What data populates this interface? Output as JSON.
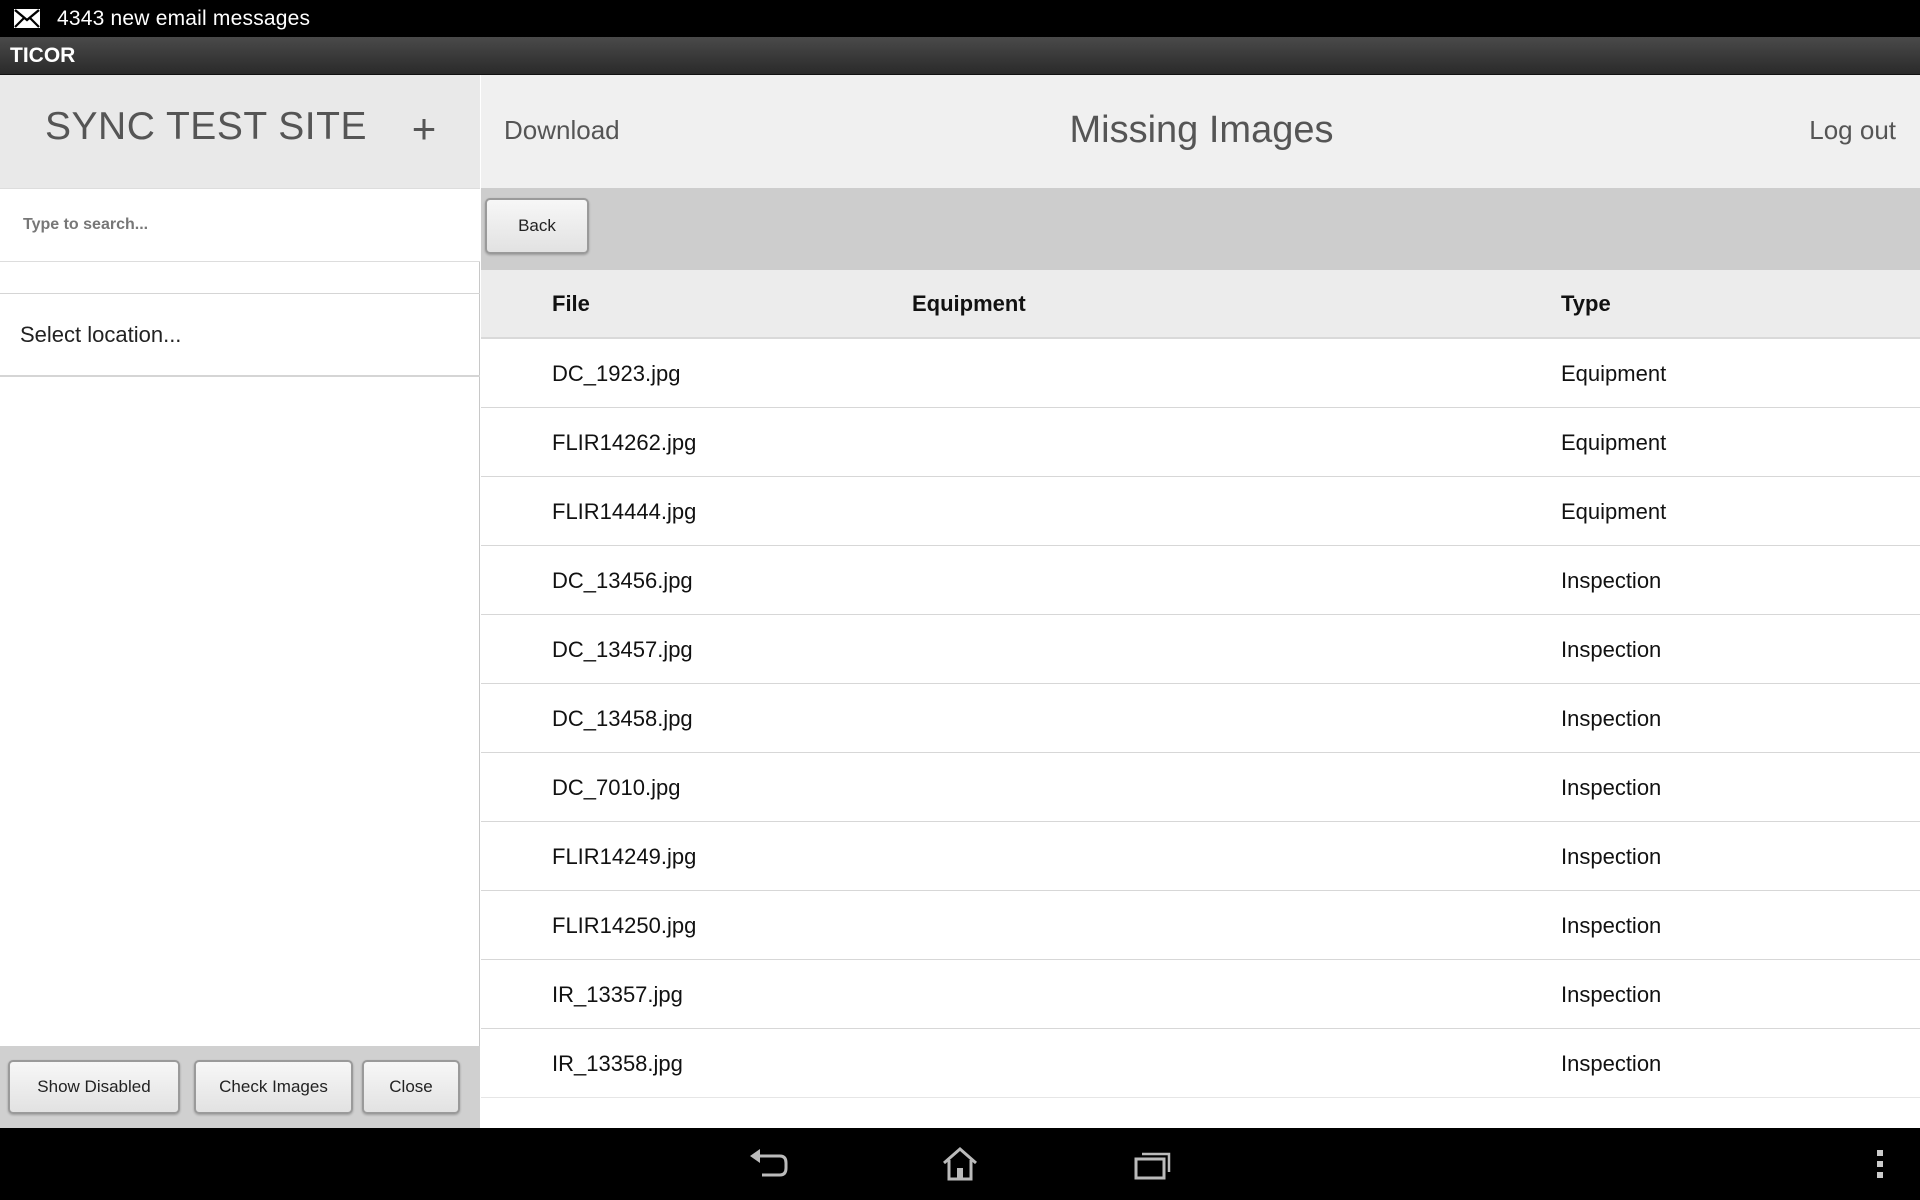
{
  "status_bar": {
    "icon": "mail-icon",
    "message": "4343 new email messages"
  },
  "title_bar": {
    "app_title": "TICOR"
  },
  "sidebar": {
    "site_title": "SYNC TEST SITE",
    "add_label": "+",
    "search_placeholder": "Type to search...",
    "location_label": "Select location...",
    "buttons": {
      "show_disabled": "Show Disabled",
      "check_images": "Check Images",
      "close": "Close"
    }
  },
  "header": {
    "download": "Download",
    "title": "Missing Images",
    "logout": "Log out"
  },
  "toolbar": {
    "back": "Back"
  },
  "table": {
    "columns": [
      "File",
      "Equipment",
      "Type"
    ],
    "rows": [
      {
        "file": "DC_1923.jpg",
        "equipment": "",
        "type": "Equipment"
      },
      {
        "file": "FLIR14262.jpg",
        "equipment": "",
        "type": "Equipment"
      },
      {
        "file": "FLIR14444.jpg",
        "equipment": "",
        "type": "Equipment"
      },
      {
        "file": "DC_13456.jpg",
        "equipment": "",
        "type": "Inspection"
      },
      {
        "file": "DC_13457.jpg",
        "equipment": "",
        "type": "Inspection"
      },
      {
        "file": "DC_13458.jpg",
        "equipment": "",
        "type": "Inspection"
      },
      {
        "file": "DC_7010.jpg",
        "equipment": "",
        "type": "Inspection"
      },
      {
        "file": "FLIR14249.jpg",
        "equipment": "",
        "type": "Inspection"
      },
      {
        "file": "FLIR14250.jpg",
        "equipment": "",
        "type": "Inspection"
      },
      {
        "file": "IR_13357.jpg",
        "equipment": "",
        "type": "Inspection"
      },
      {
        "file": "IR_13358.jpg",
        "equipment": "",
        "type": "Inspection"
      }
    ]
  },
  "nav_bar": {
    "icons": [
      "back-icon",
      "home-icon",
      "recent-apps-icon",
      "overflow-menu-icon"
    ]
  },
  "colors": {
    "sidebar_header_bg": "#e9e9e9",
    "main_header_bg": "#f0f0f0",
    "toolbar_bg": "#cdcdcd",
    "table_header_bg": "#ececec",
    "title_text": "#555555"
  }
}
